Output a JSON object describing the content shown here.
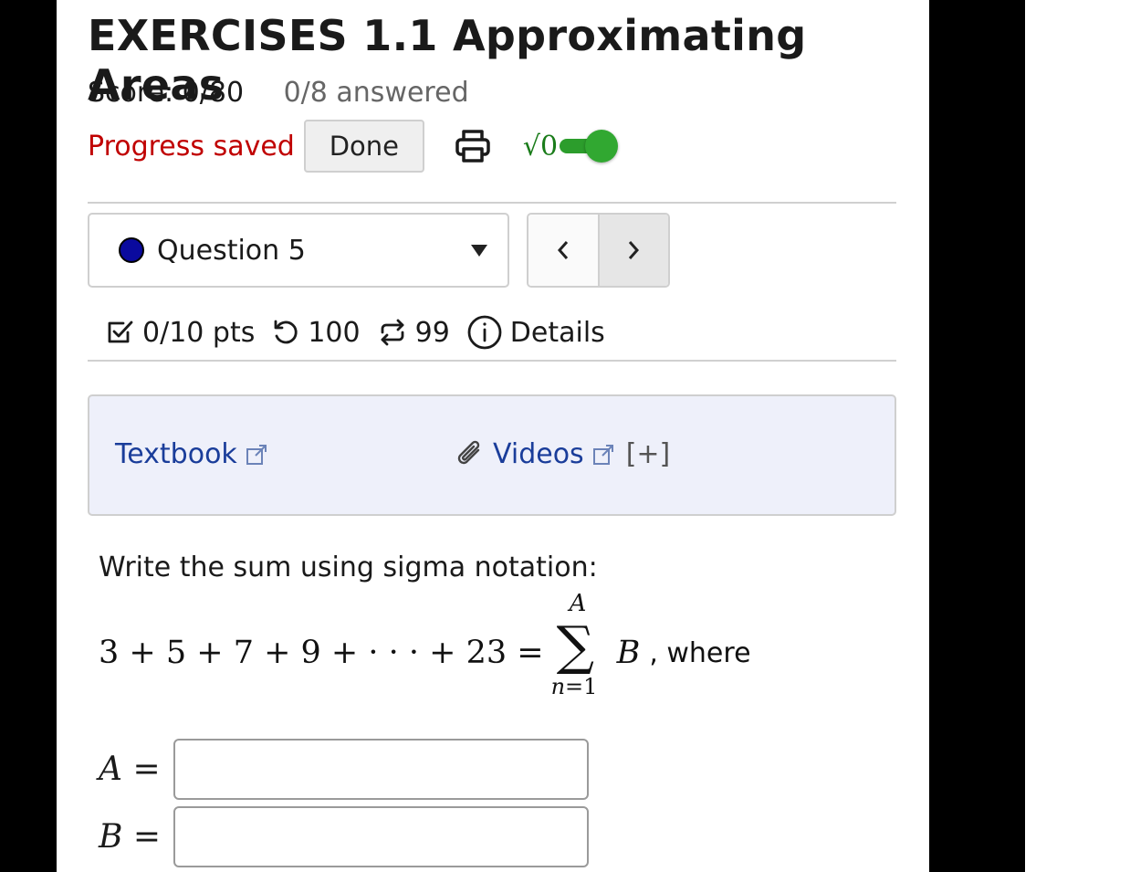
{
  "header": {
    "title": "EXERCISES 1.1 Approximating Areas",
    "score": "Score: 0/80",
    "answered": "0/8 answered"
  },
  "toolbar": {
    "progress_status": "Progress saved",
    "done_label": "Done",
    "math_toggle_glyph": "√0",
    "math_toggle_on": true,
    "toggle_color": "#31a831"
  },
  "question_nav": {
    "selected": "Question 5",
    "status_dot_color": "#0a0a9e",
    "prev_glyph": "‹",
    "next_glyph": "›"
  },
  "question_meta": {
    "points": "0/10 pts",
    "attempts": "100",
    "regenerations": "99",
    "details_label": "Details"
  },
  "resources": {
    "textbook_label": "Textbook",
    "videos_label": "Videos",
    "expand_label": "[+]"
  },
  "problem": {
    "prompt": "Write the sum using sigma notation:",
    "lhs": "3 + 5 + 7 + 9 + · · · + 23 =",
    "sigma_upper": "A",
    "sigma_lower": "n=1",
    "summand": "B",
    "suffix": ", where"
  },
  "answers": [
    {
      "label": "A",
      "value": ""
    },
    {
      "label": "B",
      "value": ""
    }
  ]
}
